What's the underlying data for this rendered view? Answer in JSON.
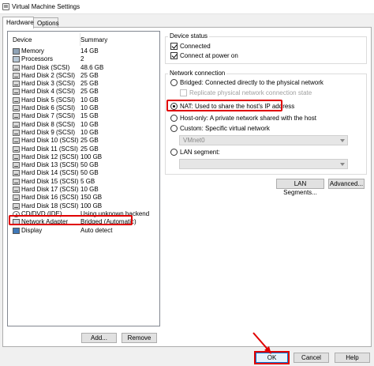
{
  "window": {
    "title": "Virtual Machine Settings"
  },
  "tabs": [
    {
      "label": "Hardware",
      "active": true
    },
    {
      "label": "Options",
      "active": false
    }
  ],
  "device_list": {
    "columns": [
      "Device",
      "Summary"
    ],
    "rows": [
      {
        "device": "Memory",
        "summary": "14 GB",
        "icon": "memory-icon"
      },
      {
        "device": "Processors",
        "summary": "2",
        "icon": "processor-icon"
      },
      {
        "device": "Hard Disk (SCSI)",
        "summary": "48.6 GB",
        "icon": "hard-disk-icon"
      },
      {
        "device": "Hard Disk 2 (SCSI)",
        "summary": "25 GB",
        "icon": "hard-disk-icon"
      },
      {
        "device": "Hard Disk 3 (SCSI)",
        "summary": "25 GB",
        "icon": "hard-disk-icon"
      },
      {
        "device": "Hard Disk 4 (SCSI)",
        "summary": "25 GB",
        "icon": "hard-disk-icon"
      },
      {
        "device": "Hard Disk 5 (SCSI)",
        "summary": "10 GB",
        "icon": "hard-disk-icon"
      },
      {
        "device": "Hard Disk 6 (SCSI)",
        "summary": "10 GB",
        "icon": "hard-disk-icon"
      },
      {
        "device": "Hard Disk 7 (SCSI)",
        "summary": "15 GB",
        "icon": "hard-disk-icon"
      },
      {
        "device": "Hard Disk 8 (SCSI)",
        "summary": "10 GB",
        "icon": "hard-disk-icon"
      },
      {
        "device": "Hard Disk 9 (SCSI)",
        "summary": "10 GB",
        "icon": "hard-disk-icon"
      },
      {
        "device": "Hard Disk 10 (SCSI)",
        "summary": "25 GB",
        "icon": "hard-disk-icon"
      },
      {
        "device": "Hard Disk 11 (SCSI)",
        "summary": "25 GB",
        "icon": "hard-disk-icon"
      },
      {
        "device": "Hard Disk 12 (SCSI)",
        "summary": "100 GB",
        "icon": "hard-disk-icon"
      },
      {
        "device": "Hard Disk 13 (SCSI)",
        "summary": "50 GB",
        "icon": "hard-disk-icon"
      },
      {
        "device": "Hard Disk 14 (SCSI)",
        "summary": "50 GB",
        "icon": "hard-disk-icon"
      },
      {
        "device": "Hard Disk 15 (SCSI)",
        "summary": "5 GB",
        "icon": "hard-disk-icon"
      },
      {
        "device": "Hard Disk 17 (SCSI)",
        "summary": "10 GB",
        "icon": "hard-disk-icon"
      },
      {
        "device": "Hard Disk 16 (SCSI)",
        "summary": "150 GB",
        "icon": "hard-disk-icon"
      },
      {
        "device": "Hard Disk 18 (SCSI)",
        "summary": "100 GB",
        "icon": "hard-disk-icon"
      },
      {
        "device": "CD/DVD (IDE)",
        "summary": "Using unknown backend",
        "icon": "cd-dvd-icon"
      },
      {
        "device": "Network Adapter",
        "summary": "Bridged (Automatic)",
        "icon": "network-adapter-icon"
      },
      {
        "device": "Display",
        "summary": "Auto detect",
        "icon": "display-icon"
      }
    ],
    "add_label": "Add...",
    "remove_label": "Remove"
  },
  "device_status": {
    "title": "Device status",
    "connected_label": "Connected",
    "connected_checked": true,
    "connect_at_power_on_label": "Connect at power on",
    "connect_at_power_on_checked": true
  },
  "network_connection": {
    "title": "Network connection",
    "bridged_label": "Bridged: Connected directly to the physical network",
    "replicate_label": "Replicate physical network connection state",
    "nat_label": "NAT: Used to share the host's IP address",
    "host_only_label": "Host-only: A private network shared with the host",
    "custom_label": "Custom: Specific virtual network",
    "custom_value": "VMnet0",
    "lan_segment_label": "LAN segment:",
    "lan_segment_value": "",
    "selected": "nat"
  },
  "buttons": {
    "lan_segments": "LAN Segments...",
    "advanced": "Advanced...",
    "ok": "OK",
    "cancel": "Cancel",
    "help": "Help"
  },
  "annotation_color": "#e00000"
}
